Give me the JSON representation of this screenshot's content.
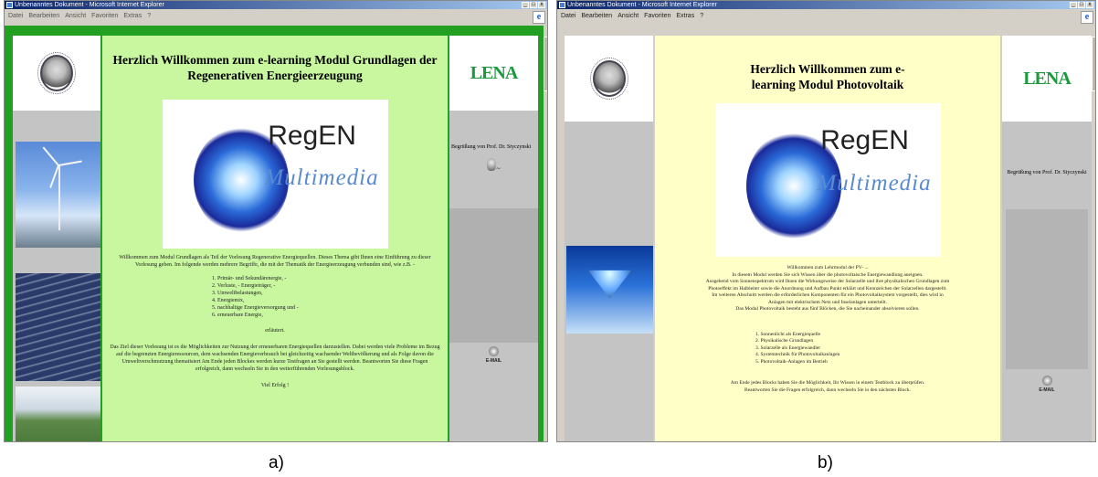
{
  "screenshot_a": {
    "window_title": "Unbenanntes Dokument - Microsoft Internet Explorer",
    "menu": [
      "Datei",
      "Bearbeiten",
      "Ansicht",
      "Favoriten",
      "Extras",
      "?"
    ],
    "heading": "Herzlich Willkommen zum e-learning Modul Grundlagen der Regenerativen Energieerzeugung",
    "logo_title": "RegEN",
    "logo_subtitle": "Multimedia",
    "lena_logo": "LENA",
    "greeting": "Begrüßung von Prof. Dr. Styczynski",
    "email_label": "E-MAIL",
    "intro": "Willkommen zum Modul Grundlagen als Teil der Vorlesung Regenerative Energiequellen. Dieses Thema gibt Ihnen eine Einführung zu dieser Vorlesung geben. Im folgende werden mehrere Begriffe, die mit der Thematik der Energieerzeugung verbunden sind, wie z.B. -",
    "list_items": [
      "1.  Primär- und Sekundärenergie, -",
      "2.  Verluste, - Energieträger, -",
      "3.  Umweltbelastungen,",
      "4.  Energiemix,",
      "5.  nachhaltige Energieversorgung und -",
      "6.  erneuerbare Energie,"
    ],
    "explained": "erläutert.",
    "goal": "Das Ziel dieser Vorlesung ist es die Möglichkeiten zur Nutzung der erneuerbaren Energiequellen darzustellen. Dabei werden viele Probleme im Bezug auf die begrenzten Energieressourcen, dem wachsenden Energieverbrauch bei gleichzeitig wachsender Weltbevölkerung und als Folge davon die Umweltverschmutzung thematisiert Am Ende jeden Blockes werden kurze Testfragen an Sie gestellt werden. Beantworten Sie diese Fragen erfolgreich, dann wechseln Sie in den weiterführenden Vorlesungsblock.",
    "success": "Viel Erfolg !"
  },
  "screenshot_b": {
    "window_title": "Unbenanntes Dokument - Microsoft Internet Explorer",
    "menu": [
      "Datei",
      "Bearbeiten",
      "Ansicht",
      "Favoriten",
      "Extras",
      "?"
    ],
    "heading": "Herzlich Willkommen zum e-learning Modul Photovoltaik",
    "logo_title": "RegEN",
    "logo_subtitle": "Multimedia",
    "lena_logo": "LENA",
    "greeting": "Begrüßung von Prof. Dr. Styczynski",
    "email_label": "E-MAIL",
    "intro_lines": [
      "Willkommen zum Lehrmodul der PV- ...",
      "In diesem Modul werden Sie sich Wissen über die photovoltaische Energiewandlung aneignen.",
      "Ausgehend vom Sonnenspektrum wird Ihnen die Wirkungsweise der Solarzelle und ihre physikalischen Grundlagen zum",
      "Photoeffekt im Halbleiter sowie die Anordnung und Aufbau Punkt erklärt und Kennzeichen der Solarzellen dargestellt.",
      "Im weiteren Abschnitt werden die erforderlichen Komponenten für ein Photovoltaiksystem vorgestellt, dies wird in",
      "Anlagen mit elektrischem Netz und Inselanlagen unterteilt.",
      "Das Modul Photovoltaik besteht aus fünf Blöcken, die Sie nacheinander absolvieren sollen."
    ],
    "list_items": [
      "1. Sonnenlicht als Energiequelle",
      "2. Physikalische Grundlagen",
      "3. Solarzelle als Energiewandler",
      "4. Systemtechnik für Photovoltaikanlagen",
      "5. Photovoltaik-Anlagen im Betrieb"
    ],
    "footer_lines": [
      "Am Ende jedes Blocks haben Sie die Möglichkeit, Ihr Wissen in einem Testblock zu überprüfen.",
      "Beantworten Sie die Fragen erfolgreich, dann wechseln Sie in den nächsten Block."
    ]
  },
  "captions": {
    "a": "a)",
    "b": "b)"
  },
  "colors": {
    "page_a_bg": "#c8f7a0",
    "page_a_border": "#22a022",
    "page_b_bg": "#ffffc8"
  }
}
